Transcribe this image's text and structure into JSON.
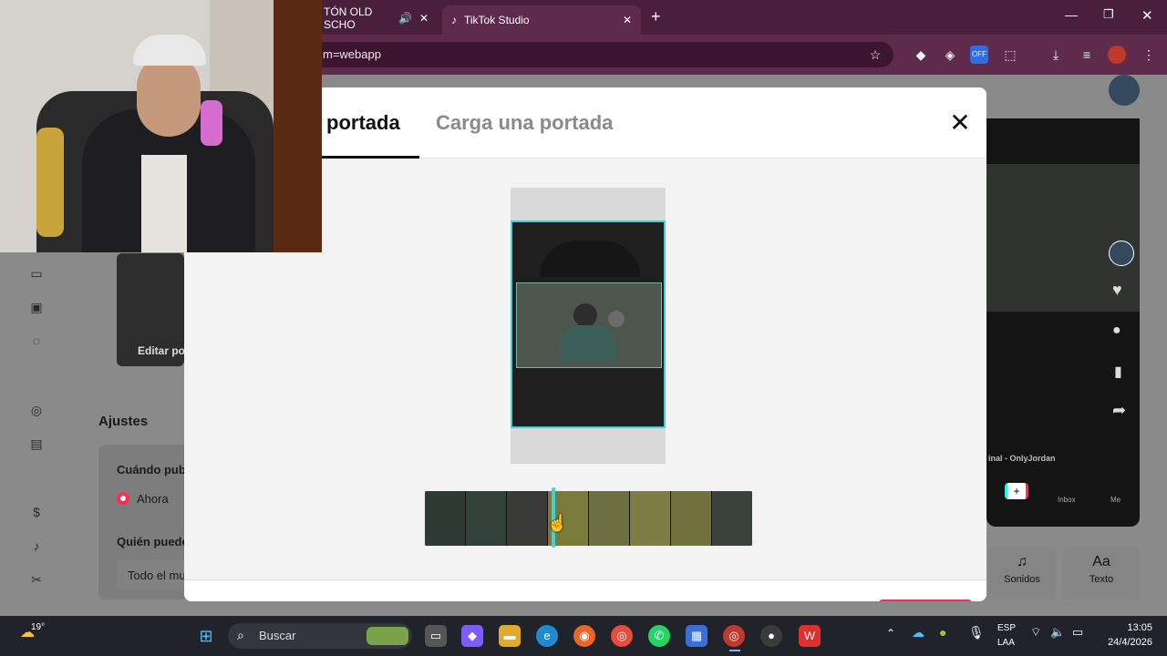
{
  "browser": {
    "tabs": [
      {
        "label": "TÓN OLD SCHO",
        "active": false
      },
      {
        "label": "TikTok Studio",
        "active": true
      }
    ],
    "url": "m=webapp"
  },
  "page": {
    "edit_cover_label": "Editar po",
    "settings_heading": "Ajustes",
    "when_label": "Cuándo pub",
    "now_option": "Ahora",
    "who_label": "Quién puede",
    "everyone_value": "Todo el mu"
  },
  "phone": {
    "song": "inal - OnlyJordan",
    "nav": [
      "Inbox",
      "Me"
    ]
  },
  "tools": {
    "sounds": "Sonidos",
    "text_icon": "Aa",
    "text": "Texto"
  },
  "modal": {
    "tab_select": "portada",
    "tab_upload": "Carga una portada",
    "close": "✕"
  },
  "taskbar": {
    "weather": "19°",
    "search": "Buscar",
    "lang": "ESP",
    "lang2": "LAA",
    "time": "13:05",
    "date": "24/4/2026"
  },
  "colors": {
    "accent": "#3fd1d8",
    "brand": "#fe2c55",
    "chrome": "#5e2b4d"
  }
}
